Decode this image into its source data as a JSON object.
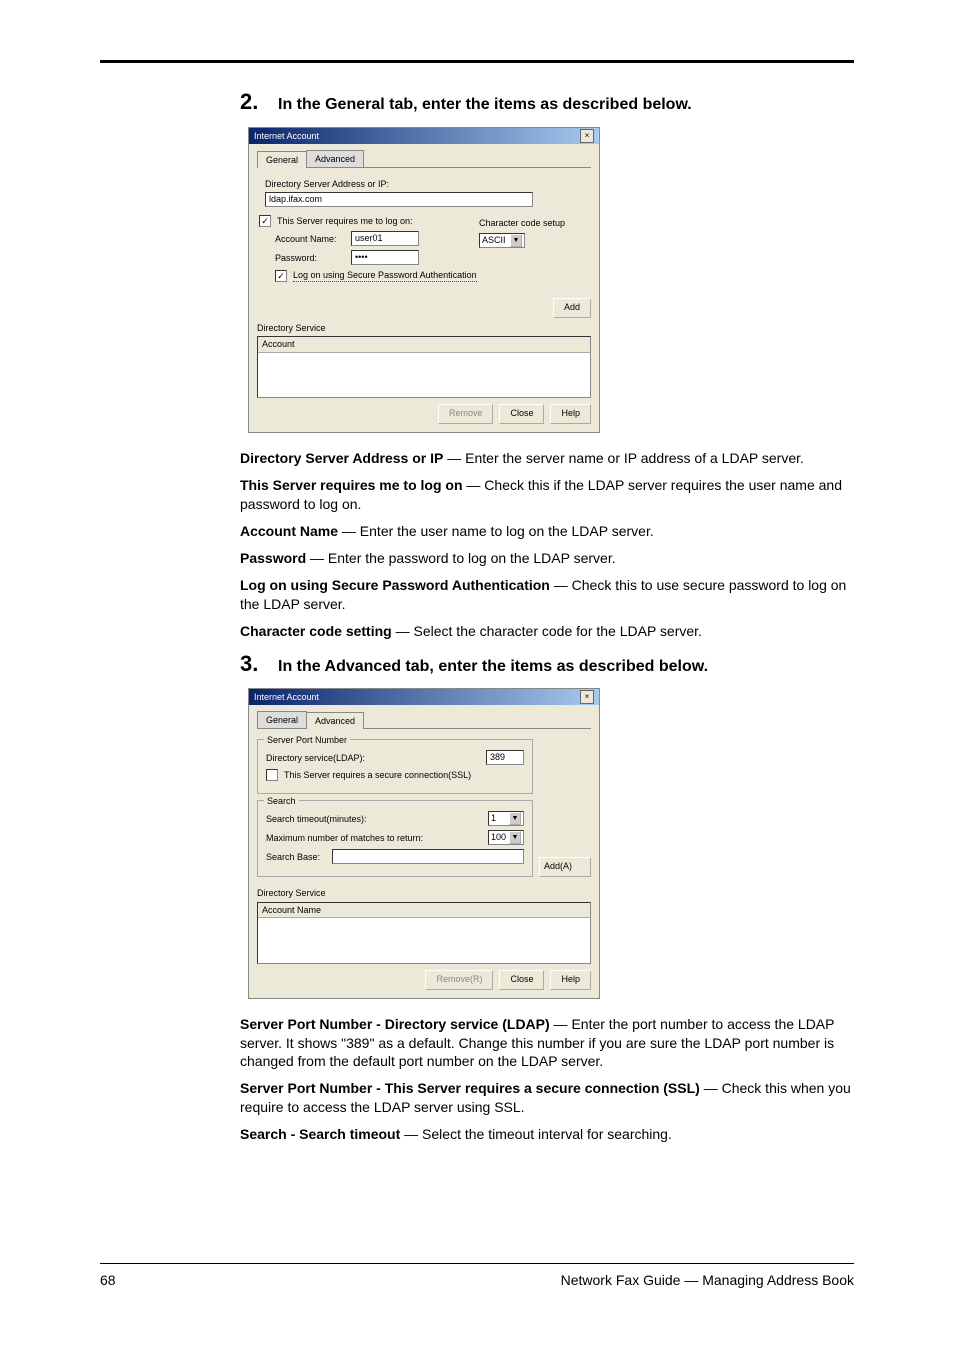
{
  "step2": {
    "number": "2.",
    "text": "In the General tab, enter the items as described below."
  },
  "dialog1": {
    "title": "Internet Account",
    "close": "×",
    "tabs": {
      "general": "General",
      "advanced": "Advanced"
    },
    "dir_server_label": "Directory Server Address or IP:",
    "dir_server_value": "ldap.ifax.com",
    "requires_logon_label": "This Server requires me to log on:",
    "requires_logon_checked": "✓",
    "account_name_label": "Account Name:",
    "account_name_value": "user01",
    "password_label": "Password:",
    "password_value": "••••",
    "secure_auth_label": "Log on using Secure Password Authentication",
    "secure_auth_checked": "✓",
    "char_code_label": "Character code setup",
    "char_code_value": "ASCII",
    "add_btn": "Add",
    "ds_label": "Directory Service",
    "list_header": "Account",
    "remove_btn": "Remove",
    "close_btn": "Close",
    "help_btn": "Help"
  },
  "desc2": {
    "t1": "Directory Server Address or IP",
    "d1": " — Enter the server name or IP address of a LDAP server.",
    "t2": "This Server requires me to log on",
    "d2": " — Check this if the LDAP server requires the user name and password to log on.",
    "t3": "Account Name",
    "d3": " — Enter the user name to log on the LDAP server.",
    "t4": "Password",
    "d4": " — Enter the password to log on the LDAP server.",
    "t5": "Log on using Secure Password Authentication",
    "d5": " — Check this to use secure password to log on the LDAP server.",
    "t6": "Character code setting",
    "d6": " — Select the character code for the LDAP server."
  },
  "step3": {
    "number": "3.",
    "text": "In the Advanced tab, enter the items as described below."
  },
  "dialog2": {
    "title": "Internet Account",
    "close": "×",
    "tabs": {
      "general": "General",
      "advanced": "Advanced"
    },
    "group_port": "Server Port Number",
    "port_label": "Directory service(LDAP):",
    "port_value": "389",
    "ssl_label": "This Server requires a secure connection(SSL)",
    "group_search": "Search",
    "timeout_label": "Search timeout(minutes):",
    "timeout_value": "1",
    "max_label": "Maximum number of matches to return:",
    "max_value": "100",
    "base_label": "Search Base:",
    "base_value": "",
    "add_btn": "Add(A)",
    "ds_label": "Directory Service",
    "list_header": "Account Name",
    "remove_btn": "Remove(R)",
    "close_btn": "Close",
    "help_btn": "Help"
  },
  "desc3": {
    "t1": "Server Port Number - Directory service (LDAP)",
    "d1": " — Enter the port number to access the LDAP server. It shows \"389\" as a default. Change this number if you are sure the LDAP port number is changed from the default port number on the LDAP server.",
    "t2": "Server Port Number - This Server requires a secure connection (SSL)",
    "d2": " — Check this when you require to access the LDAP server using SSL.",
    "t3": "Search - Search timeout",
    "d3": " — Select the timeout interval for searching."
  },
  "footer": {
    "page": "68",
    "text": "Network Fax Guide — Managing Address Book"
  }
}
